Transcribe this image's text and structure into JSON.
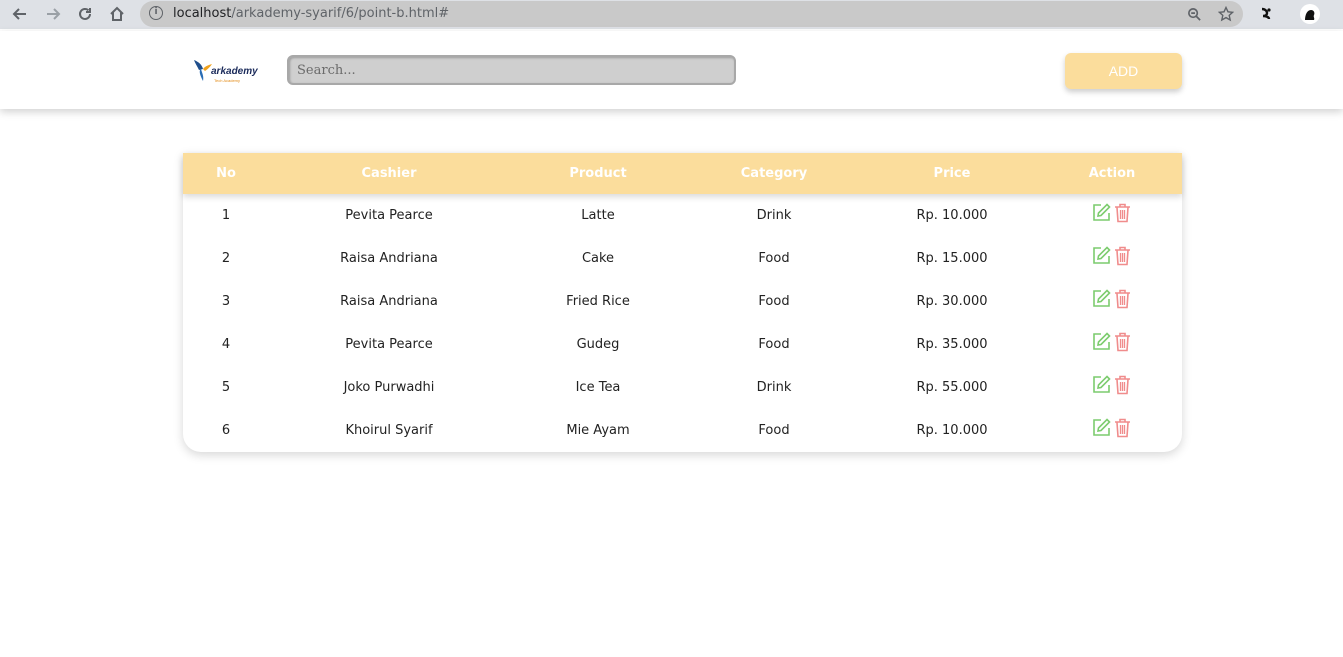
{
  "browser": {
    "url_host": "localhost",
    "url_path": "/arkademy-syarif/6/point-b.html#"
  },
  "header": {
    "logo_text": "arkademy",
    "logo_subtext": "Tech Academy",
    "search_placeholder": "Search...",
    "add_label": "ADD"
  },
  "table": {
    "columns": [
      "No",
      "Cashier",
      "Product",
      "Category",
      "Price",
      "Action"
    ],
    "rows": [
      {
        "no": "1",
        "cashier": "Pevita Pearce",
        "product": "Latte",
        "category": "Drink",
        "price": "Rp. 10.000"
      },
      {
        "no": "2",
        "cashier": "Raisa Andriana",
        "product": "Cake",
        "category": "Food",
        "price": "Rp. 15.000"
      },
      {
        "no": "3",
        "cashier": "Raisa Andriana",
        "product": "Fried Rice",
        "category": "Food",
        "price": "Rp. 30.000"
      },
      {
        "no": "4",
        "cashier": "Pevita Pearce",
        "product": "Gudeg",
        "category": "Food",
        "price": "Rp. 35.000"
      },
      {
        "no": "5",
        "cashier": "Joko Purwadhi",
        "product": "Ice Tea",
        "category": "Drink",
        "price": "Rp. 55.000"
      },
      {
        "no": "6",
        "cashier": "Khoirul Syarif",
        "product": "Mie Ayam",
        "category": "Food",
        "price": "Rp. 10.000"
      }
    ]
  },
  "colors": {
    "accent": "#fbdd9c",
    "edit": "#7ccc6e",
    "delete": "#f08c8c"
  }
}
